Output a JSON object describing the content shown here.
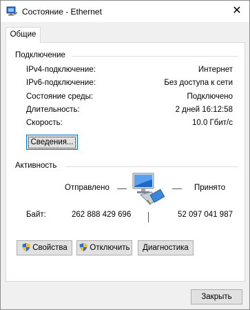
{
  "window": {
    "title": "Состояние - Ethernet",
    "close_glyph": "✕"
  },
  "tabs": [
    {
      "label": "Общие"
    }
  ],
  "connection": {
    "heading": "Подключение",
    "rows": [
      {
        "label": "IPv4-подключение:",
        "value": "Интернет"
      },
      {
        "label": "IPv6-подключение:",
        "value": "Без доступа к сети"
      },
      {
        "label": "Состояние среды:",
        "value": "Подключено"
      },
      {
        "label": "Длительность:",
        "value": "2 дней 16:12:58"
      },
      {
        "label": "Скорость:",
        "value": "10.0 Гбит/с"
      }
    ],
    "details_button": "Сведения..."
  },
  "activity": {
    "heading": "Активность",
    "sent_label": "Отправлено",
    "received_label": "Принято",
    "bytes_label": "Байт:",
    "bytes_sent": "262 888 429 696",
    "bytes_received": "52 097 041 987"
  },
  "actions": {
    "properties": "Свойства",
    "disable": "Отключить",
    "diagnose": "Диагностика"
  },
  "footer": {
    "close_button": "Закрыть"
  },
  "icons": {
    "title": "network-adapter-icon",
    "activity": "network-computers-icon",
    "shield": "uac-shield-icon"
  }
}
